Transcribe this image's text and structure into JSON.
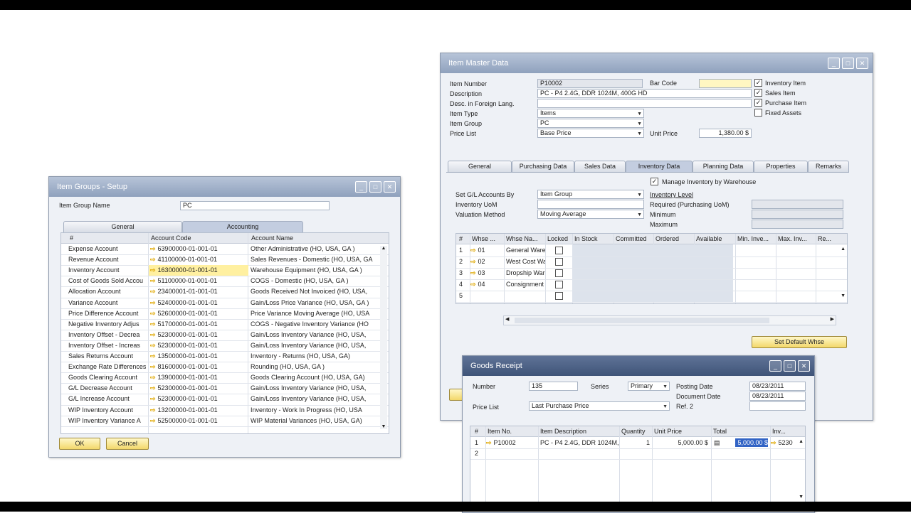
{
  "item_groups": {
    "title": "Item Groups - Setup",
    "name_label": "Item Group Name",
    "name_value": "PC",
    "tabs": [
      "General",
      "Accounting"
    ],
    "columns": [
      "#",
      "Account Code",
      "Account Name"
    ],
    "rows": [
      {
        "label": "Expense Account",
        "code": "63900000-01-001-01",
        "name": "Other Administrative (HO, USA, GA )"
      },
      {
        "label": "Revenue Account",
        "code": "41100000-01-001-01",
        "name": "Sales Revenues - Domestic (HO, USA, GA"
      },
      {
        "label": "Inventory Account",
        "code": "16300000-01-001-01",
        "name": "Warehouse Equipment (HO, USA, GA )"
      },
      {
        "label": "Cost of Goods Sold Accou",
        "code": "51100000-01-001-01",
        "name": "COGS - Domestic (HO, USA, GA )"
      },
      {
        "label": "Allocation Account",
        "code": "23400001-01-001-01",
        "name": "Goods Received Not Invoiced (HO, USA,"
      },
      {
        "label": "Variance Account",
        "code": "52400000-01-001-01",
        "name": "Gain/Loss Price Variance (HO, USA, GA )"
      },
      {
        "label": "Price Difference Account",
        "code": "52600000-01-001-01",
        "name": "Price Variance Moving Average (HO, USA"
      },
      {
        "label": "Negative Inventory Adjus",
        "code": "51700000-01-001-01",
        "name": "COGS - Negative Inventory Variance (HO"
      },
      {
        "label": "Inventory Offset - Decrea",
        "code": "52300000-01-001-01",
        "name": "Gain/Loss Inventory Variance (HO, USA,"
      },
      {
        "label": "Inventory Offset - Increas",
        "code": "52300000-01-001-01",
        "name": "Gain/Loss Inventory Variance (HO, USA,"
      },
      {
        "label": "Sales Returns Account",
        "code": "13500000-01-001-01",
        "name": "Inventory - Returns (HO, USA, GA)"
      },
      {
        "label": "Exchange Rate Differences",
        "code": "81600000-01-001-01",
        "name": "Rounding (HO, USA, GA )"
      },
      {
        "label": "Goods Clearing Account",
        "code": "13900000-01-001-01",
        "name": "Goods Clearing Account (HO, USA, GA)"
      },
      {
        "label": "G/L Decrease Account",
        "code": "52300000-01-001-01",
        "name": "Gain/Loss Inventory Variance (HO, USA,"
      },
      {
        "label": "G/L Increase Account",
        "code": "52300000-01-001-01",
        "name": "Gain/Loss Inventory Variance (HO, USA,"
      },
      {
        "label": "WIP Inventory Account",
        "code": "13200000-01-001-01",
        "name": "Inventory - Work In Progress (HO, USA"
      },
      {
        "label": "WIP Inventory Variance A",
        "code": "52500000-01-001-01",
        "name": "WIP Material Variances (HO, USA, GA)"
      }
    ],
    "ok_label": "OK",
    "cancel_label": "Cancel"
  },
  "item_master": {
    "title": "Item Master Data",
    "item_number_label": "Item Number",
    "item_number": "P10002",
    "description_label": "Description",
    "description": "PC - P4 2.4G, DDR 1024M, 400G HD",
    "foreign_label": "Desc. in Foreign Lang.",
    "foreign": "",
    "item_type_label": "Item Type",
    "item_type": "Items",
    "item_group_label": "Item Group",
    "item_group": "PC",
    "price_list_label": "Price List",
    "price_list": "Base Price",
    "bar_code_label": "Bar Code",
    "bar_code": "",
    "unit_price_label": "Unit Price",
    "unit_price": "1,380.00 $",
    "checks": [
      {
        "label": "Inventory Item",
        "checked": true
      },
      {
        "label": "Sales Item",
        "checked": true
      },
      {
        "label": "Purchase Item",
        "checked": true
      },
      {
        "label": "Fixed Assets",
        "checked": false
      }
    ],
    "tabs": [
      "General",
      "Purchasing Data",
      "Sales Data",
      "Inventory Data",
      "Planning Data",
      "Properties",
      "Remarks"
    ],
    "manage_by_whse": "Manage Inventory by Warehouse",
    "set_gl_label": "Set G/L Accounts By",
    "set_gl": "Item Group",
    "uom_label": "Inventory UoM",
    "uom": "",
    "valuation_label": "Valuation Method",
    "valuation": "Moving Average",
    "inv_level": "Inventory Level",
    "required_label": "Required (Purchasing UoM)",
    "minimum_label": "Minimum",
    "maximum_label": "Maximum",
    "whse_columns": [
      "#",
      "Whse ...",
      "Whse Na...",
      "Locked",
      "In Stock",
      "Committed",
      "Ordered",
      "Available",
      "Min. Inve...",
      "Max. Inv...",
      "Re..."
    ],
    "whse_rows": [
      {
        "n": "1",
        "code": "01",
        "name": "General Warehouse"
      },
      {
        "n": "2",
        "code": "02",
        "name": "West Cost Warehouse"
      },
      {
        "n": "3",
        "code": "03",
        "name": "Dropship Warehouse"
      },
      {
        "n": "4",
        "code": "04",
        "name": "Consignment"
      },
      {
        "n": "5",
        "code": "",
        "name": ""
      }
    ],
    "set_default_label": "Set Default Whse"
  },
  "goods_receipt": {
    "title": "Goods Receipt",
    "number_label": "Number",
    "number": "135",
    "series_label": "Series",
    "series": "Primary",
    "posting_label": "Posting Date",
    "posting": "08/23/2011",
    "document_label": "Document Date",
    "document": "08/23/2011",
    "ref_label": "Ref. 2",
    "ref": "",
    "price_list_label": "Price List",
    "price_list": "Last Purchase Price",
    "columns": [
      "#",
      "Item No.",
      "Item Description",
      "Quantity",
      "Unit Price",
      "Total",
      "Inv..."
    ],
    "rows": [
      {
        "n": "1",
        "item": "P10002",
        "desc": "PC - P4 2.4G, DDR 1024M,",
        "qty": "1",
        "price": "5,000.00 $",
        "total": "5,000.00 $",
        "inv": "5230"
      },
      {
        "n": "2",
        "item": "",
        "desc": "",
        "qty": "",
        "price": "",
        "total": "",
        "inv": ""
      }
    ]
  }
}
